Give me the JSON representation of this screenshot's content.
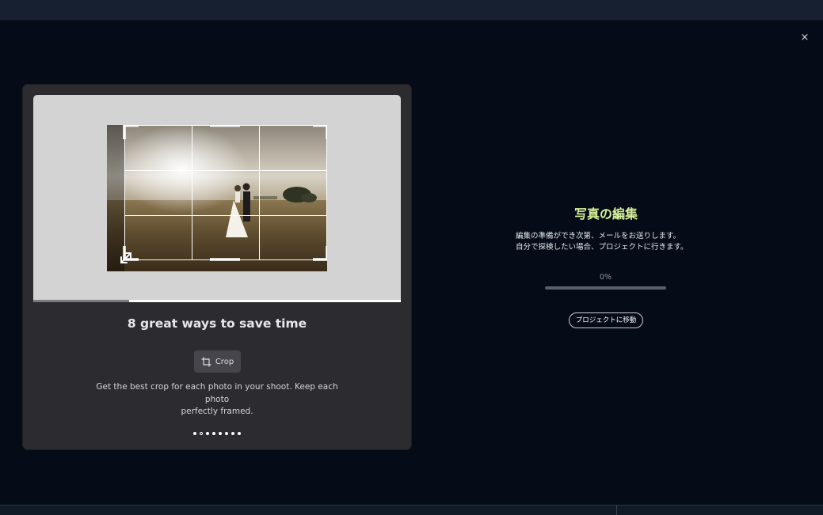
{
  "window": {
    "close_glyph": "×"
  },
  "carousel": {
    "preview_progress_percent": 26,
    "slide_title": "8 great ways to save time",
    "feature": {
      "label": "Crop",
      "icon": "crop-icon"
    },
    "description_line1": "Get the best crop for each photo in your shoot. Keep each photo",
    "description_line2": "perfectly framed.",
    "dots": {
      "count": 8,
      "active_index": 1
    }
  },
  "status": {
    "title": "写真の編集",
    "message_line1": "編集の準備ができ次第、メールをお送りします。",
    "message_line2": "自分で探検したい場合、プロジェクトに行きます。",
    "progress_label": "0%",
    "progress_value": 0,
    "goto_button_label": "プロジェクトに移動"
  },
  "colors": {
    "background": "#050b17",
    "accent_green": "#d6f19a",
    "card": "#2c2c30"
  }
}
